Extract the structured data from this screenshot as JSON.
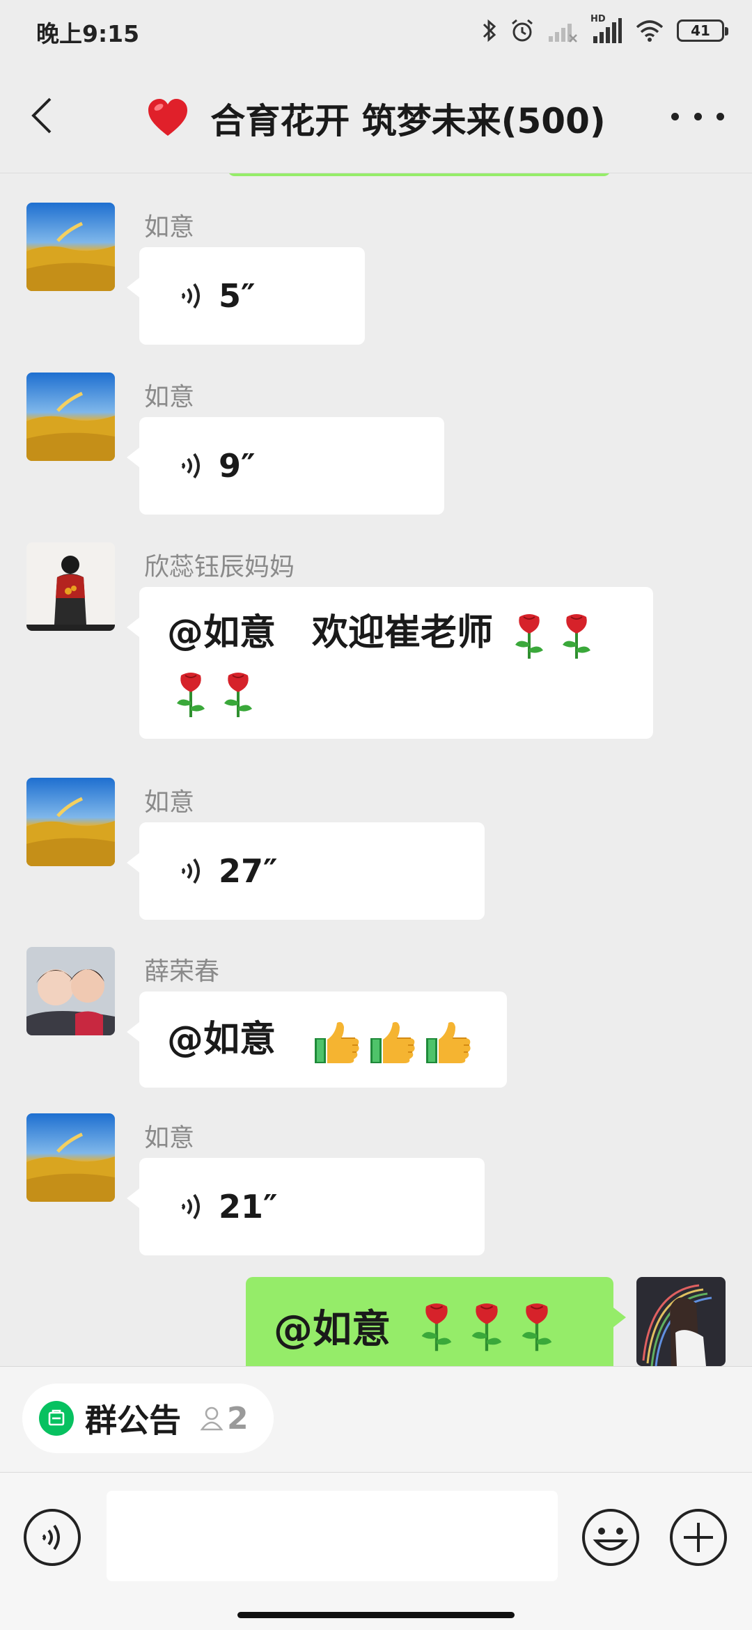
{
  "status_bar": {
    "time": "晚上9:15",
    "hd_label": "HD",
    "battery": "41"
  },
  "header": {
    "title": "合育花开 筑梦未来(500)"
  },
  "messages": [
    {
      "sender": "如意",
      "type": "voice",
      "duration": "5″"
    },
    {
      "sender": "如意",
      "type": "voice",
      "duration": "9″"
    },
    {
      "sender": "欣蕊钰辰妈妈",
      "type": "text",
      "text": "@如意　欢迎崔老师",
      "emoji": "rose",
      "emoji_count": 4
    },
    {
      "sender": "如意",
      "type": "voice",
      "duration": "27″"
    },
    {
      "sender": "薛荣春",
      "type": "text",
      "text": "@如意",
      "emoji": "thumbs-up",
      "emoji_count": 3
    },
    {
      "sender": "如意",
      "type": "voice",
      "duration": "21″"
    }
  ],
  "self_message": {
    "text": "@如意",
    "emoji": "rose",
    "emoji_count": 3
  },
  "notice": {
    "label": "群公告",
    "count": "2"
  },
  "input": {
    "value": "",
    "placeholder": ""
  },
  "colors": {
    "self_bubble": "#95ec69",
    "background": "#ededed",
    "notice_icon": "#07c160"
  }
}
